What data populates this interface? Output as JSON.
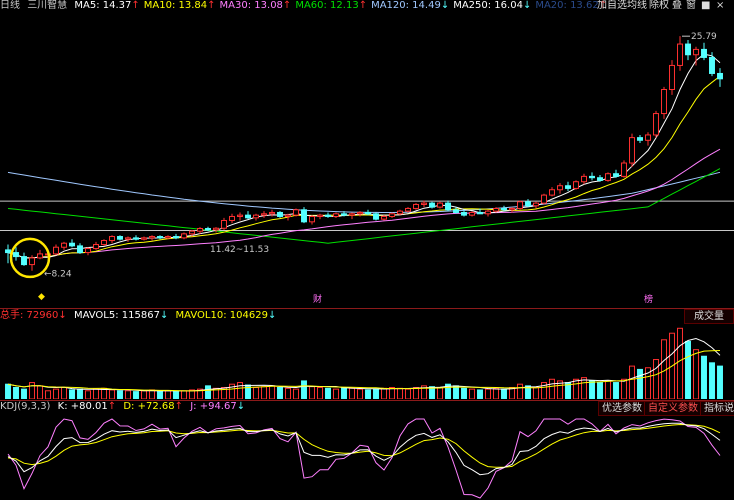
{
  "top": {
    "period": "日线",
    "stock_name": "三川智慧",
    "ma_items": [
      {
        "label": "MA5: 14.37",
        "arrow": "↑",
        "color": "#ffffff"
      },
      {
        "label": "MA10: 13.84",
        "arrow": "↑",
        "color": "#ffff00"
      },
      {
        "label": "MA30: 13.08",
        "arrow": "↑",
        "color": "#ff80ff"
      },
      {
        "label": "MA60: 12.13",
        "arrow": "↑",
        "color": "#00e000"
      },
      {
        "label": "MA120: 14.49",
        "arrow": "↓",
        "color": "#a0c8ff"
      },
      {
        "label": "MA250: 16.04",
        "arrow": "↓",
        "color": "#ffffff"
      },
      {
        "label": "MA20: 13.62",
        "arrow": "↑",
        "color": "#2a4a8a"
      }
    ],
    "buttons": [
      "加自选",
      "均线",
      "除权"
    ],
    "icons": [
      "叠",
      "窗",
      "■"
    ]
  },
  "annotations": {
    "high": "25.79",
    "low": "8.24",
    "range": "11.42~11.53",
    "marker_cai": "财",
    "marker_bang": "榜"
  },
  "volume": {
    "total": "总手: 72960",
    "total_arrow": "↓",
    "mavol5": "MAVOL5: 115867",
    "mavol5_arrow": "↓",
    "mavol10": "MAVOL10: 104629",
    "mavol10_arrow": "↓",
    "button": "成交量"
  },
  "kdj": {
    "title": "KDJ(9,3,3)",
    "k": "K: +80.01",
    "k_arrow": "↑",
    "d": "D: +72.68",
    "d_arrow": "↑",
    "j": "J: +94.67",
    "j_arrow": "↓",
    "buttons": [
      "优选参数",
      "自定义参数",
      "指标说明"
    ]
  },
  "colors": {
    "up": "#ff3030",
    "down": "#54ffff",
    "grid": "#8b1a1a",
    "ma5": "#ffffff",
    "ma10": "#ffff00",
    "ma30": "#ff80ff",
    "ma60": "#00e000",
    "ma120": "#a0c8ff",
    "k": "#ffffff",
    "d": "#ffff00",
    "j": "#ff80ff"
  },
  "chart_data": {
    "type": "candlestick",
    "high_label": 25.79,
    "low_label": 8.24,
    "price_range": [
      6.5,
      27
    ],
    "candles": [
      [
        9.8,
        10.2,
        8.8,
        9.6
      ],
      [
        9.6,
        10.0,
        9.0,
        9.3
      ],
      [
        9.3,
        9.6,
        8.6,
        8.7
      ],
      [
        8.7,
        9.4,
        8.24,
        9.2
      ],
      [
        9.2,
        9.8,
        9.1,
        9.5
      ],
      [
        9.5,
        9.6,
        9.2,
        9.5
      ],
      [
        9.5,
        10.2,
        9.4,
        10.0
      ],
      [
        10.0,
        10.4,
        9.8,
        10.3
      ],
      [
        10.3,
        10.6,
        10.0,
        10.1
      ],
      [
        10.1,
        10.3,
        9.5,
        9.6
      ],
      [
        9.6,
        10.0,
        9.4,
        9.9
      ],
      [
        9.9,
        10.4,
        9.8,
        10.2
      ],
      [
        10.2,
        10.6,
        10.1,
        10.5
      ],
      [
        10.5,
        10.9,
        10.3,
        10.8
      ],
      [
        10.8,
        10.9,
        10.5,
        10.6
      ],
      [
        10.6,
        10.8,
        10.4,
        10.7
      ],
      [
        10.7,
        10.9,
        10.5,
        10.6
      ],
      [
        10.6,
        10.8,
        10.5,
        10.7
      ],
      [
        10.7,
        10.9,
        10.5,
        10.8
      ],
      [
        10.8,
        10.9,
        10.6,
        10.7
      ],
      [
        10.7,
        10.9,
        10.6,
        10.8
      ],
      [
        10.8,
        11.0,
        10.6,
        10.7
      ],
      [
        10.7,
        11.1,
        10.6,
        11.0
      ],
      [
        11.0,
        11.3,
        10.8,
        11.2
      ],
      [
        11.2,
        11.5,
        11.0,
        11.4
      ],
      [
        11.4,
        11.53,
        11.2,
        11.3
      ],
      [
        11.3,
        11.5,
        11.1,
        11.42
      ],
      [
        11.42,
        12.2,
        11.3,
        12.0
      ],
      [
        12.0,
        12.5,
        11.8,
        12.3
      ],
      [
        12.3,
        12.6,
        12.0,
        12.4
      ],
      [
        12.4,
        12.7,
        12.1,
        12.2
      ],
      [
        12.2,
        12.5,
        12.0,
        12.4
      ],
      [
        12.4,
        12.7,
        12.2,
        12.5
      ],
      [
        12.5,
        12.8,
        12.3,
        12.6
      ],
      [
        12.6,
        12.7,
        12.2,
        12.3
      ],
      [
        12.3,
        12.5,
        12.0,
        12.4
      ],
      [
        12.4,
        12.9,
        12.3,
        12.8
      ],
      [
        12.8,
        13.0,
        11.8,
        11.9
      ],
      [
        11.9,
        12.4,
        11.7,
        12.3
      ],
      [
        12.3,
        12.5,
        12.1,
        12.4
      ],
      [
        12.4,
        12.6,
        12.2,
        12.3
      ],
      [
        12.3,
        12.6,
        12.2,
        12.5
      ],
      [
        12.5,
        12.7,
        12.3,
        12.4
      ],
      [
        12.4,
        12.6,
        12.1,
        12.5
      ],
      [
        12.5,
        12.7,
        12.3,
        12.6
      ],
      [
        12.6,
        12.8,
        12.4,
        12.5
      ],
      [
        12.5,
        12.6,
        12.0,
        12.1
      ],
      [
        12.1,
        12.4,
        12.0,
        12.3
      ],
      [
        12.3,
        12.6,
        12.2,
        12.5
      ],
      [
        12.5,
        12.8,
        12.4,
        12.7
      ],
      [
        12.7,
        13.0,
        12.6,
        12.9
      ],
      [
        12.9,
        13.3,
        12.8,
        13.2
      ],
      [
        13.2,
        13.5,
        13.0,
        13.3
      ],
      [
        13.3,
        13.4,
        12.9,
        13.0
      ],
      [
        13.0,
        13.4,
        12.9,
        13.3
      ],
      [
        13.3,
        13.5,
        12.7,
        12.8
      ],
      [
        12.8,
        13.0,
        12.5,
        12.6
      ],
      [
        12.6,
        12.8,
        12.3,
        12.4
      ],
      [
        12.4,
        12.7,
        12.3,
        12.6
      ],
      [
        12.6,
        12.9,
        12.5,
        12.5
      ],
      [
        12.5,
        12.8,
        12.3,
        12.7
      ],
      [
        12.7,
        13.0,
        12.6,
        12.9
      ],
      [
        12.9,
        13.1,
        12.7,
        12.8
      ],
      [
        12.8,
        13.0,
        12.6,
        12.9
      ],
      [
        12.9,
        13.5,
        12.8,
        13.4
      ],
      [
        13.4,
        13.6,
        13.0,
        13.1
      ],
      [
        13.1,
        13.4,
        12.9,
        13.3
      ],
      [
        13.3,
        14.0,
        13.2,
        13.9
      ],
      [
        13.9,
        14.5,
        13.8,
        14.3
      ],
      [
        14.3,
        14.8,
        14.0,
        14.6
      ],
      [
        14.6,
        14.9,
        14.2,
        14.4
      ],
      [
        14.4,
        15.0,
        14.3,
        14.9
      ],
      [
        14.9,
        15.5,
        14.7,
        15.3
      ],
      [
        15.3,
        15.6,
        15.0,
        15.2
      ],
      [
        15.2,
        15.4,
        14.9,
        15.0
      ],
      [
        15.0,
        15.6,
        14.9,
        15.5
      ],
      [
        15.5,
        15.8,
        15.2,
        15.3
      ],
      [
        15.3,
        16.5,
        15.2,
        16.3
      ],
      [
        16.3,
        18.5,
        16.0,
        18.2
      ],
      [
        18.2,
        18.4,
        17.8,
        18.0
      ],
      [
        18.0,
        18.6,
        17.6,
        18.4
      ],
      [
        18.4,
        20.2,
        18.2,
        20.0
      ],
      [
        20.0,
        22.0,
        19.6,
        21.8
      ],
      [
        21.8,
        24.0,
        21.4,
        23.6
      ],
      [
        23.6,
        25.79,
        23.2,
        25.2
      ],
      [
        25.2,
        25.5,
        24.0,
        24.4
      ],
      [
        24.4,
        25.0,
        23.6,
        24.8
      ],
      [
        24.8,
        25.3,
        24.0,
        24.2
      ],
      [
        24.2,
        24.6,
        22.8,
        23.0
      ],
      [
        23.0,
        23.4,
        22.0,
        22.6
      ]
    ],
    "volumes": [
      18,
      14,
      12,
      20,
      16,
      10,
      12,
      14,
      11,
      12,
      10,
      12,
      13,
      11,
      10,
      10,
      9,
      10,
      11,
      9,
      10,
      9,
      10,
      11,
      12,
      16,
      13,
      14,
      18,
      20,
      17,
      14,
      15,
      16,
      14,
      13,
      12,
      22,
      15,
      14,
      13,
      12,
      14,
      13,
      12,
      11,
      12,
      13,
      14,
      13,
      12,
      14,
      16,
      15,
      14,
      18,
      16,
      13,
      12,
      11,
      12,
      13,
      12,
      14,
      18,
      16,
      14,
      20,
      24,
      22,
      20,
      24,
      26,
      22,
      20,
      22,
      20,
      24,
      40,
      36,
      38,
      48,
      72,
      80,
      86,
      70,
      60,
      52,
      44,
      40
    ]
  }
}
